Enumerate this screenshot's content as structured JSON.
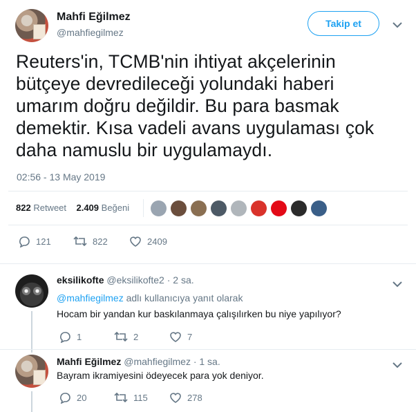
{
  "author": {
    "name": "Mahfi Eğilmez",
    "handle": "@mahfiegilmez"
  },
  "follow_label": "Takip et",
  "tweet": {
    "text_lines": [
      "Reuters'in, TCMB'nin ihtiyat akçelerinin",
      "bütçeye devredileceği yolundaki haberi",
      "umarım doğru değildir. Bu para basmak",
      "demektir. Kısa vadeli avans uygulaması çok",
      "daha namuslu bir uygulamaydı."
    ],
    "timestamp": "02:56 - 13 May 2019"
  },
  "stats": {
    "retweets": "822",
    "retweets_label": "Retweet",
    "likes": "2.409",
    "likes_label": "Beğeni"
  },
  "liker_colors": [
    "#9aa5b1",
    "#6b4e3d",
    "#8a6f52",
    "#4d5a66",
    "#b0b6bb",
    "#d9332b",
    "#e30a17",
    "#2b2b2b",
    "#3a5f88"
  ],
  "actions": {
    "replies": "121",
    "retweets": "822",
    "likes": "2409"
  },
  "replies": [
    {
      "name": "eksilikofte",
      "handle": "@eksilikofte2",
      "time": "· 2 sa.",
      "reply_to_handle": "@mahfiegilmez",
      "reply_to_suffix": "adlı kullanıcıya yanıt olarak",
      "text": "Hocam bir yandan kur baskılanmaya çalışılırken bu niye yapılıyor?",
      "replies": "1",
      "retweets": "2",
      "likes": "7"
    },
    {
      "name": "Mahfi Eğilmez",
      "handle": "@mahfiegilmez",
      "time": "· 1 sa.",
      "text": "Bayram ikramiyesini ödeyecek para yok deniyor.",
      "replies": "20",
      "retweets": "115",
      "likes": "278"
    }
  ]
}
